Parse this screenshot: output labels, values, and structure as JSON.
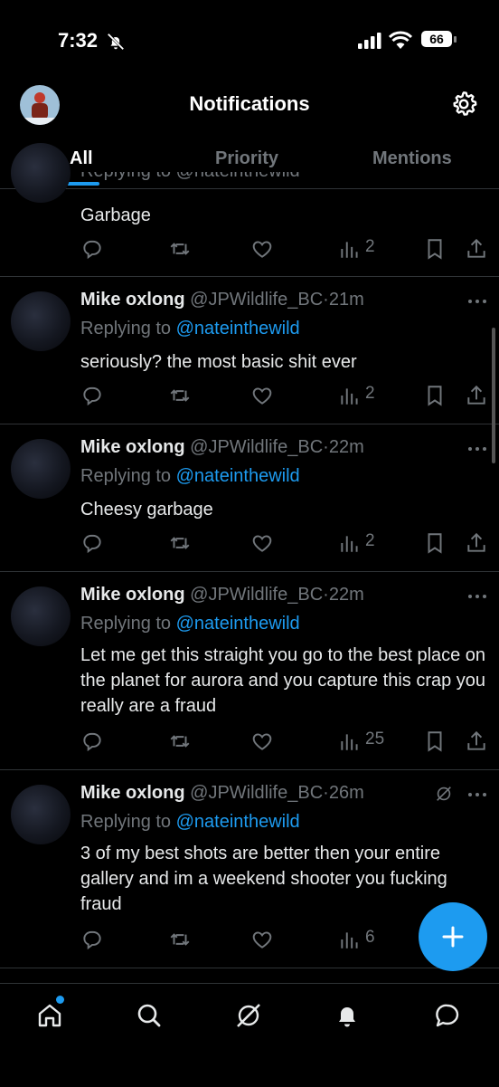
{
  "status": {
    "time": "7:32",
    "battery": "66"
  },
  "header": {
    "title": "Notifications"
  },
  "tabs": [
    {
      "label": "All"
    },
    {
      "label": "Priority"
    },
    {
      "label": "Mentions"
    }
  ],
  "items": [
    {
      "partial_reply": "Replying to @nateinthewild",
      "text": "Garbage",
      "views": "2"
    },
    {
      "name": "Mike oxlong",
      "handle": "@JPWildlife_BC",
      "sep": "·",
      "time": "21m",
      "replying_to": "Replying to",
      "mention": "@nateinthewild",
      "text": "seriously? the most basic shit ever",
      "views": "2"
    },
    {
      "name": "Mike oxlong",
      "handle": "@JPWildlife_BC",
      "sep": "·",
      "time": "22m",
      "replying_to": "Replying to",
      "mention": "@nateinthewild",
      "text": "Cheesy garbage",
      "views": "2"
    },
    {
      "name": "Mike oxlong",
      "handle": "@JPWildlife_BC",
      "sep": "·",
      "time": "22m",
      "replying_to": "Replying to",
      "mention": "@nateinthewild",
      "text": "Let me get this straight you go to the best place on the planet for aurora and you capture this crap you really are a fraud",
      "views": "25"
    },
    {
      "name": "Mike oxlong",
      "handle": "@JPWildlife_BC",
      "sep": "·",
      "time": "26m",
      "replying_to": "Replying to",
      "mention": "@nateinthewild",
      "text": "3 of my best shots are better then your entire gallery and im a weekend shooter you fucking fraud",
      "views": "6"
    }
  ],
  "colors": {
    "accent": "#1d9bf0",
    "background": "#000000",
    "muted": "#71767b",
    "divider": "#2f3336"
  },
  "icons": {
    "actions": [
      "reply-icon",
      "retweet-icon",
      "like-icon",
      "views-icon",
      "bookmark-icon",
      "share-icon"
    ],
    "nav": [
      "home-icon",
      "search-icon",
      "grok-icon",
      "notifications-bell-icon",
      "messages-icon"
    ]
  }
}
